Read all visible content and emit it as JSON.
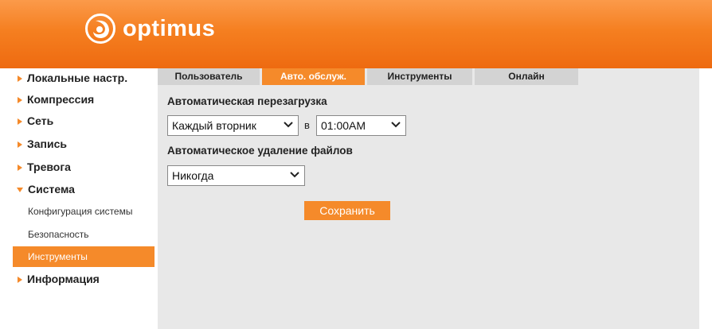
{
  "header": {
    "brand": "optimus",
    "logo_icon": "optimus-logo-icon",
    "bg_color": "#f57f20"
  },
  "sidebar": {
    "items": [
      {
        "label": "Локальные настр.",
        "expanded": false
      },
      {
        "label": "Компрессия",
        "expanded": false
      },
      {
        "label": "Сеть",
        "expanded": false
      },
      {
        "label": "Запись",
        "expanded": false
      },
      {
        "label": "Тревога",
        "expanded": false
      },
      {
        "label": "Система",
        "expanded": true
      },
      {
        "label": "Информация",
        "expanded": false
      }
    ],
    "sub_items": [
      {
        "label": "Конфигурация системы",
        "active": false
      },
      {
        "label": "Безопасность",
        "active": false
      },
      {
        "label": "Инструменты",
        "active": true
      }
    ]
  },
  "tabs": [
    {
      "label": "Пользователь",
      "active": false
    },
    {
      "label": "Авто. обслуж.",
      "active": true
    },
    {
      "label": "Инструменты",
      "active": false
    },
    {
      "label": "Онлайн",
      "active": false
    }
  ],
  "auto_reboot": {
    "title": "Автоматическая перезагрузка",
    "day_value": "Каждый вторник",
    "in_label": "в",
    "time_value": "01:00AM"
  },
  "auto_delete": {
    "title": "Автоматическое удаление файлов",
    "value": "Никогда"
  },
  "save_label": "Сохранить",
  "colors": {
    "accent": "#f58a2a",
    "panel_bg": "#e8e8e8",
    "tab_bg": "#d3d3d3"
  }
}
